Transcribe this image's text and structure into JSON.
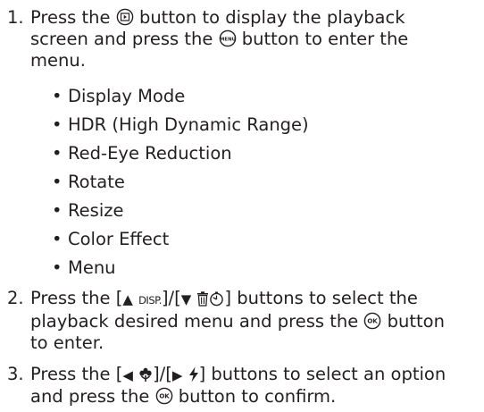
{
  "steps": [
    {
      "number": "1.",
      "text_a": "Press the",
      "text_b": "button to display the playback",
      "text_c": "screen and press the",
      "text_d": "button to enter the",
      "text_e": "menu.",
      "icons": [
        "playback-button-icon",
        "menu-button-icon"
      ]
    },
    {
      "number": "2.",
      "text_a": "Press the [",
      "key_up_disp": "DISP.",
      "mid": "]/[",
      "text_b": "] buttons to select the",
      "text_c": "playback desired menu and press the",
      "text_d": "button",
      "text_e": "to enter.",
      "icons": [
        "up-arrow-icon",
        "down-arrow-icon",
        "trash-icon",
        "self-timer-icon",
        "ok-button-icon"
      ]
    },
    {
      "number": "3.",
      "text_a": "Press the [",
      "mid": "]/[",
      "text_b": "] buttons to select an option",
      "text_c": "and press the",
      "text_d": "button to confirm.",
      "icons": [
        "left-arrow-icon",
        "macro-flower-icon",
        "right-arrow-icon",
        "flash-icon",
        "ok-button-icon"
      ]
    }
  ],
  "menu_items": [
    "Display Mode",
    "HDR (High Dynamic Range)",
    "Red-Eye Reduction",
    "Rotate",
    "Resize",
    "Color Effect",
    "Menu"
  ],
  "bullet_char": "•",
  "colors": {
    "text": "#231f20",
    "background": "#ffffff"
  }
}
